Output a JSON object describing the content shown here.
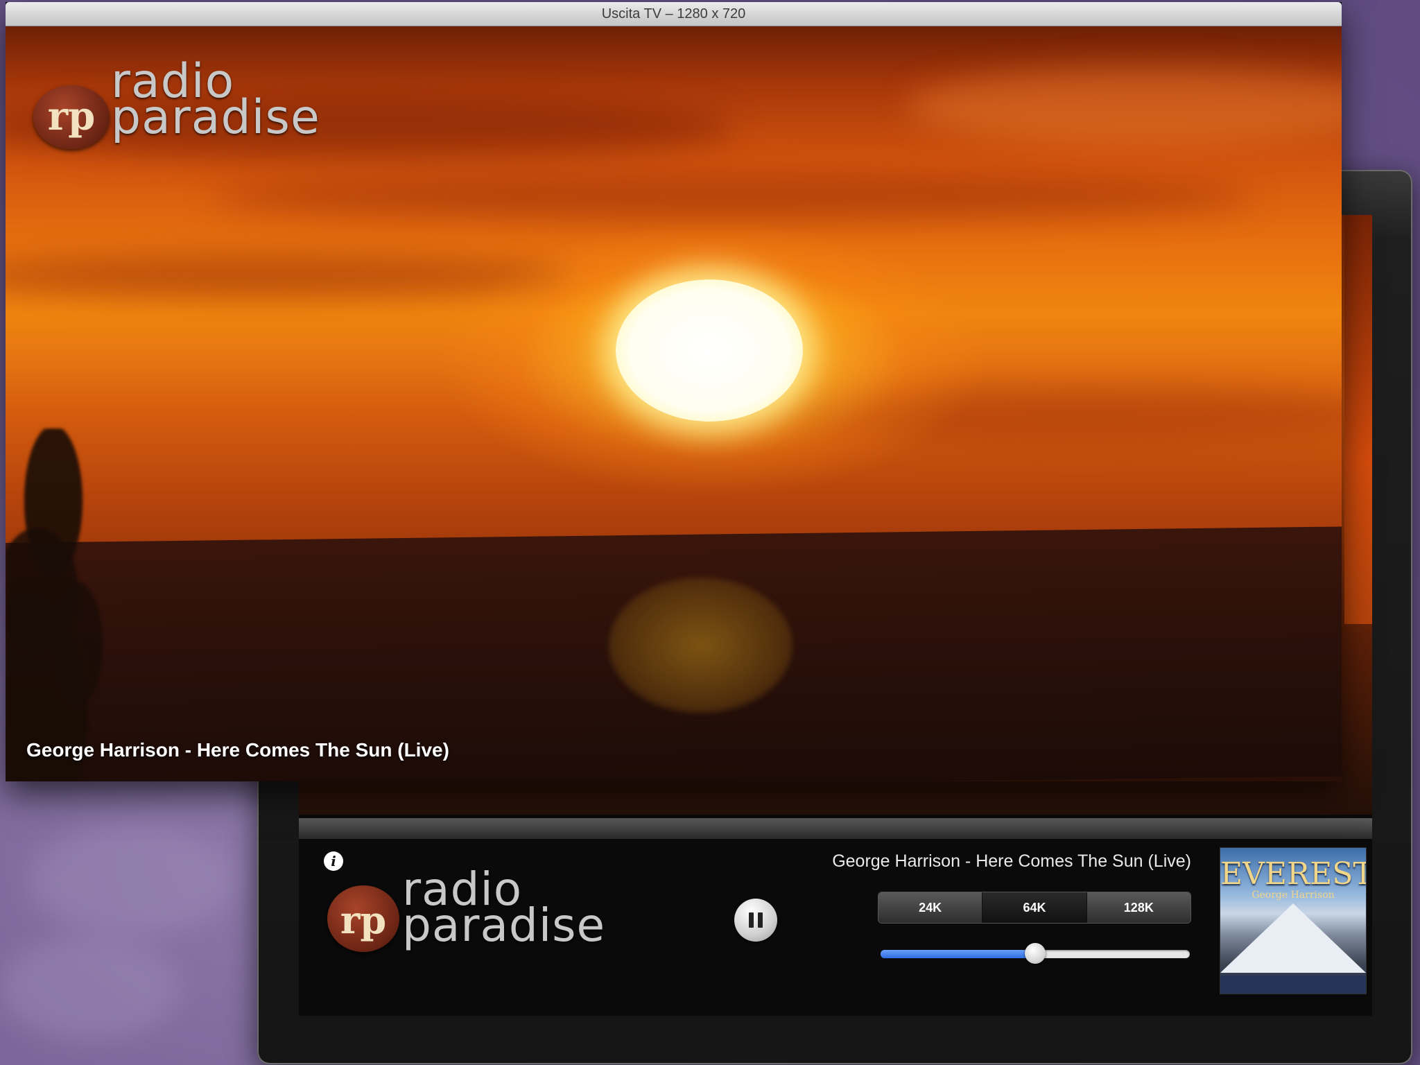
{
  "tv_window": {
    "title": "Uscita TV – 1280 x 720",
    "logo": {
      "badge": "rp",
      "line1": "radio",
      "line2": "paradise"
    },
    "now_playing": "George Harrison - Here Comes The Sun (Live)"
  },
  "player": {
    "logo": {
      "badge": "rp",
      "line1": "radio",
      "line2": "paradise"
    },
    "info_icon_glyph": "i",
    "track_title": "George Harrison - Here Comes The Sun (Live)",
    "quality_options": [
      "24K",
      "64K",
      "128K"
    ],
    "quality_selected": "64K",
    "volume_percent": 50,
    "album_art": {
      "title": "EVEREST",
      "subtitle": "George Harrison"
    }
  },
  "colors": {
    "accent": "#2f6de0",
    "sun": "#fff6b0",
    "sky": "#e8720f"
  },
  "icons": [
    "info-icon",
    "pause-icon"
  ]
}
